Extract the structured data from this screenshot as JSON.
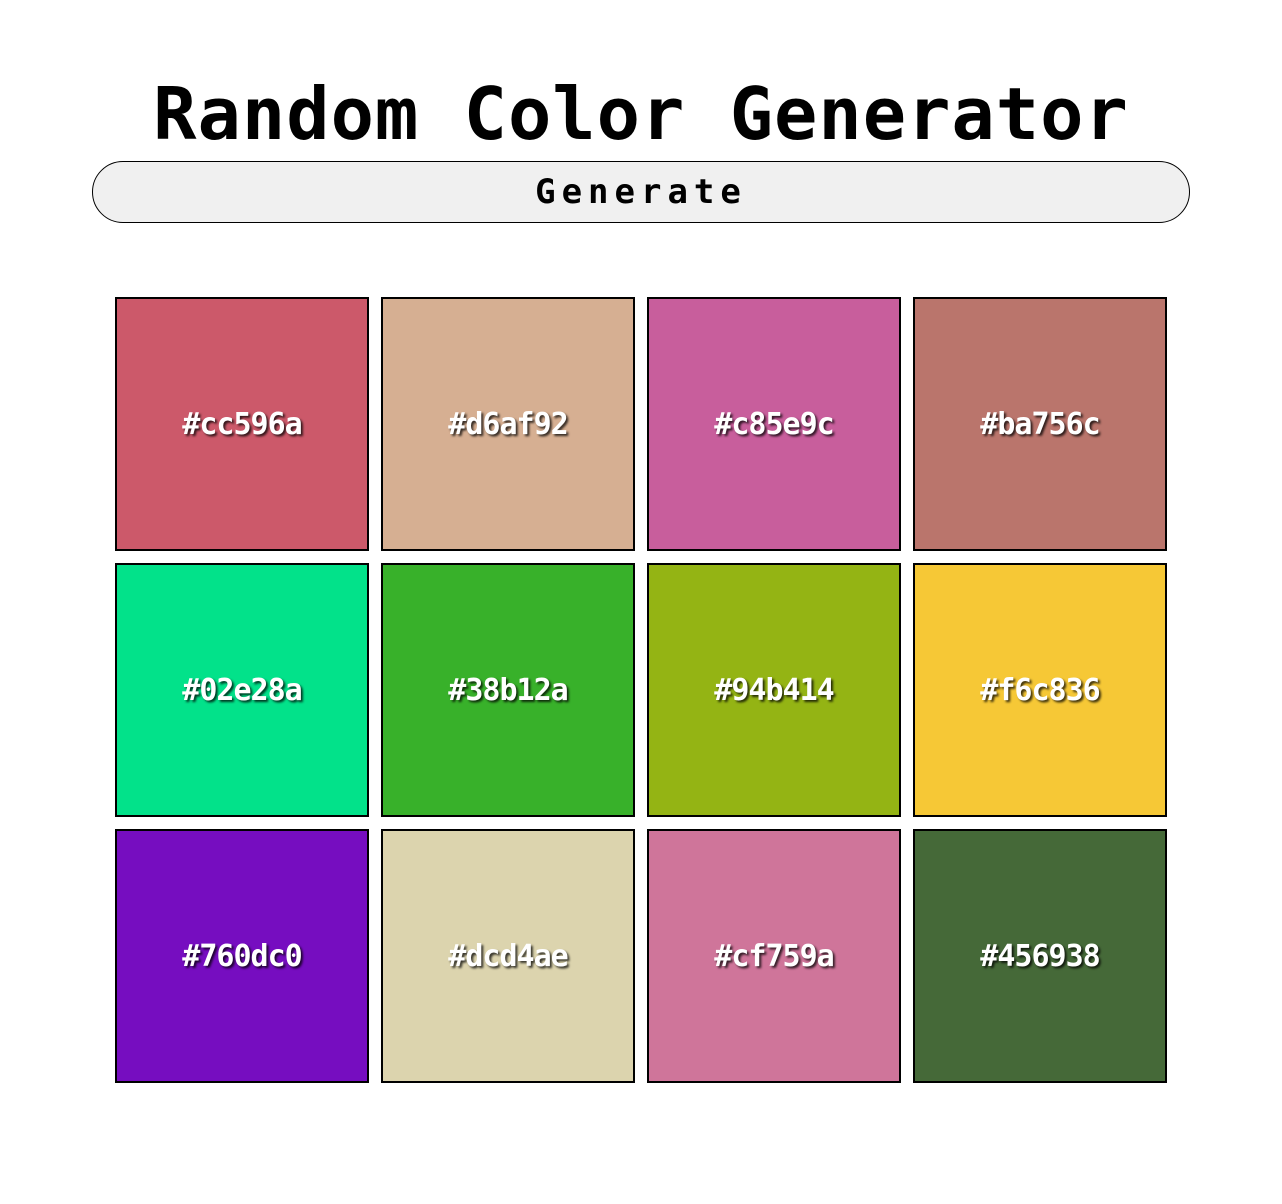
{
  "header": {
    "title": "Random Color Generator"
  },
  "controls": {
    "generate_label": "Generate"
  },
  "swatches": [
    {
      "hex": "#cc596a"
    },
    {
      "hex": "#d6af92"
    },
    {
      "hex": "#c85e9c"
    },
    {
      "hex": "#ba756c"
    },
    {
      "hex": "#02e28a"
    },
    {
      "hex": "#38b12a"
    },
    {
      "hex": "#94b414"
    },
    {
      "hex": "#f6c836"
    },
    {
      "hex": "#760dc0"
    },
    {
      "hex": "#dcd4ae"
    },
    {
      "hex": "#cf759a"
    },
    {
      "hex": "#456938"
    }
  ]
}
